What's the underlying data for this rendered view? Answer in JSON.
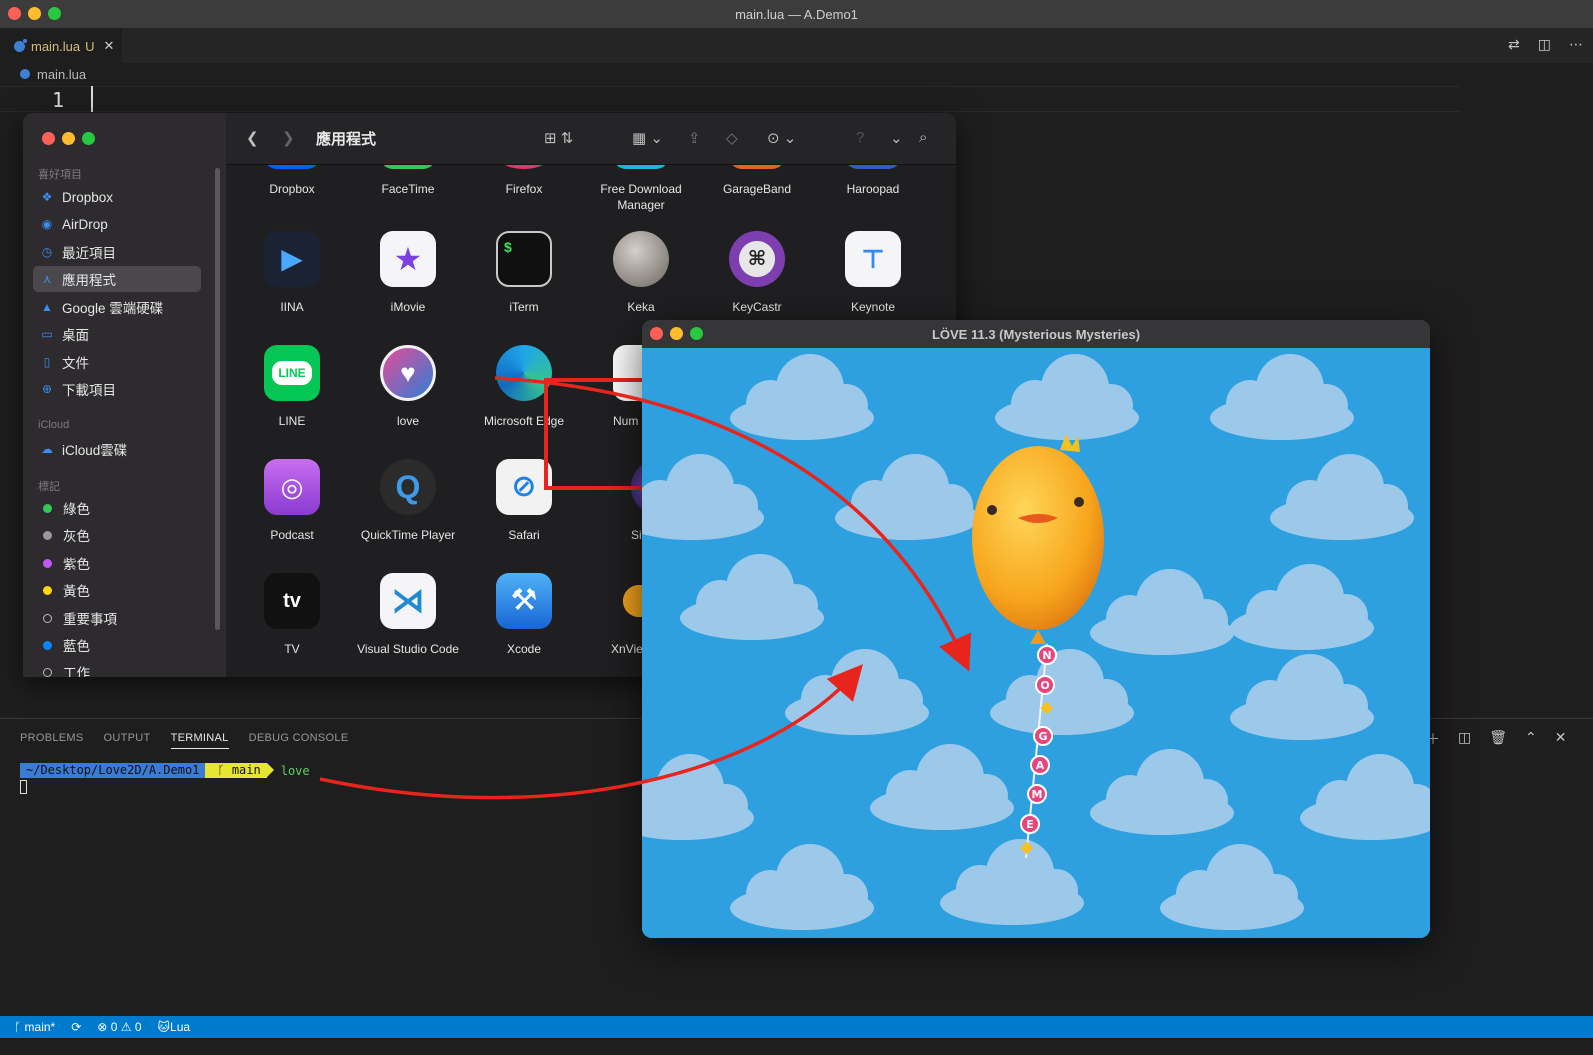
{
  "window": {
    "title": "main.lua — A.Demo1"
  },
  "tab": {
    "name": "main.lua",
    "status": "U",
    "close": "✕"
  },
  "breadcrumb": {
    "file": "main.lua"
  },
  "editor": {
    "line_number": "1"
  },
  "panel": {
    "tabs": [
      "PROBLEMS",
      "OUTPUT",
      "TERMINAL",
      "DEBUG CONSOLE"
    ],
    "active_tab": "TERMINAL",
    "prompt_path": "~/Desktop/Love2D/A.Demo1",
    "prompt_branch": "ᚴ main",
    "command": "love"
  },
  "statusbar": {
    "branch": "main*",
    "errors": "0",
    "warnings": "0",
    "language": "Lua"
  },
  "finder": {
    "title": "應用程式",
    "sections": {
      "favorites": "喜好項目",
      "icloud": "iCloud",
      "tags": "標記"
    },
    "favorites": [
      "Dropbox",
      "AirDrop",
      "最近項目",
      "應用程式",
      "Google 雲端硬碟",
      "桌面",
      "文件",
      "下載項目"
    ],
    "icloud_items": [
      "iCloud雲碟"
    ],
    "tags": [
      {
        "label": "綠色",
        "color": "#34c759"
      },
      {
        "label": "灰色",
        "color": "#98989d"
      },
      {
        "label": "紫色",
        "color": "#bf5af2"
      },
      {
        "label": "黃色",
        "color": "#ffd60a"
      },
      {
        "label": "重要事項",
        "color": ""
      },
      {
        "label": "藍色",
        "color": "#0a84ff"
      },
      {
        "label": "工作",
        "color": ""
      }
    ],
    "apps_row1": [
      "Dropbox",
      "FaceTime",
      "Firefox",
      "Free Download Manager",
      "GarageBand",
      "Haroopad"
    ],
    "apps_row2": [
      "IINA",
      "iMovie",
      "iTerm",
      "Keka",
      "KeyCastr",
      "Keynote"
    ],
    "apps_row3": [
      "LINE",
      "love",
      "Microsoft Edge",
      "Num"
    ],
    "apps_row4": [
      "Podcast",
      "QuickTime Player",
      "Safari",
      "Si"
    ],
    "apps_row5": [
      "TV",
      "Visual Studio Code",
      "Xcode",
      "XnVie"
    ],
    "icon_text": {
      "line": "LINE",
      "tv": "tv",
      "iterm": "$"
    }
  },
  "love_window": {
    "title": "LÖVE 11.3 (Mysterious Mysteries)",
    "string_letters": [
      "N",
      "O",
      "G",
      "A",
      "M",
      "E"
    ]
  },
  "colors": {
    "accent": "#007acc",
    "annotation": "#e8251c",
    "sky": "#2ea0df"
  }
}
